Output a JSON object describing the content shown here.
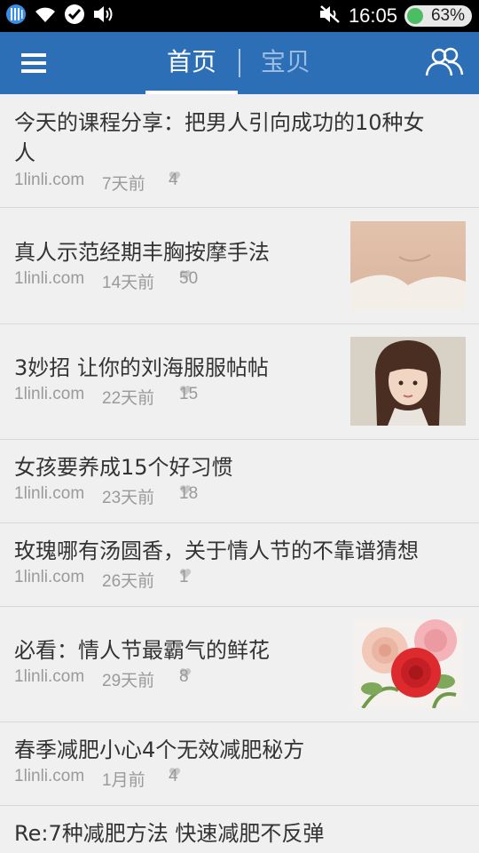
{
  "status_bar": {
    "time": "16:05",
    "battery": "63%",
    "battery_level": 0.63,
    "left_icons": [
      "signal-icon",
      "wifi-icon",
      "chat-icon",
      "volume-icon"
    ],
    "right_icons": [
      "mute-icon"
    ]
  },
  "header": {
    "tabs": [
      {
        "label": "首页",
        "active": true
      },
      {
        "label": "宝贝",
        "active": false
      }
    ],
    "left_icon": "menu-icon",
    "right_icon": "users-icon",
    "accent_color": "#2d6fb7"
  },
  "articles": [
    {
      "title_lines": [
        "今天的课程分享：把男人引向成功的10种女",
        "人"
      ],
      "site": "1linli.com",
      "time": "7天前",
      "likes": "4",
      "thumbnail": null
    },
    {
      "title_lines": [
        "真人示范经期丰胸按摩手法"
      ],
      "site": "1linli.com",
      "time": "14天前",
      "likes": "50",
      "thumbnail": "shoulder-photo"
    },
    {
      "title_lines": [
        "3妙招 让你的刘海服服帖帖"
      ],
      "site": "1linli.com",
      "time": "22天前",
      "likes": "15",
      "thumbnail": "girl-bangs-photo"
    },
    {
      "title_lines": [
        "女孩要养成15个好习惯"
      ],
      "site": "1linli.com",
      "time": "23天前",
      "likes": "18",
      "thumbnail": null
    },
    {
      "title_lines": [
        "玫瑰哪有汤圆香，关于情人节的不靠谱猜想"
      ],
      "site": "1linli.com",
      "time": "26天前",
      "likes": "1",
      "thumbnail": null
    },
    {
      "title_lines": [
        "必看：情人节最霸气的鲜花"
      ],
      "site": "1linli.com",
      "time": "29天前",
      "likes": "8",
      "thumbnail": "roses-photo"
    },
    {
      "title_lines": [
        "春季减肥小心4个无效减肥秘方"
      ],
      "site": "1linli.com",
      "time": "1月前",
      "likes": "4",
      "thumbnail": null
    },
    {
      "title_lines": [
        "Re:7种减肥方法 快速减肥不反弹"
      ],
      "site": "",
      "time": "",
      "likes": "",
      "thumbnail": null
    }
  ]
}
